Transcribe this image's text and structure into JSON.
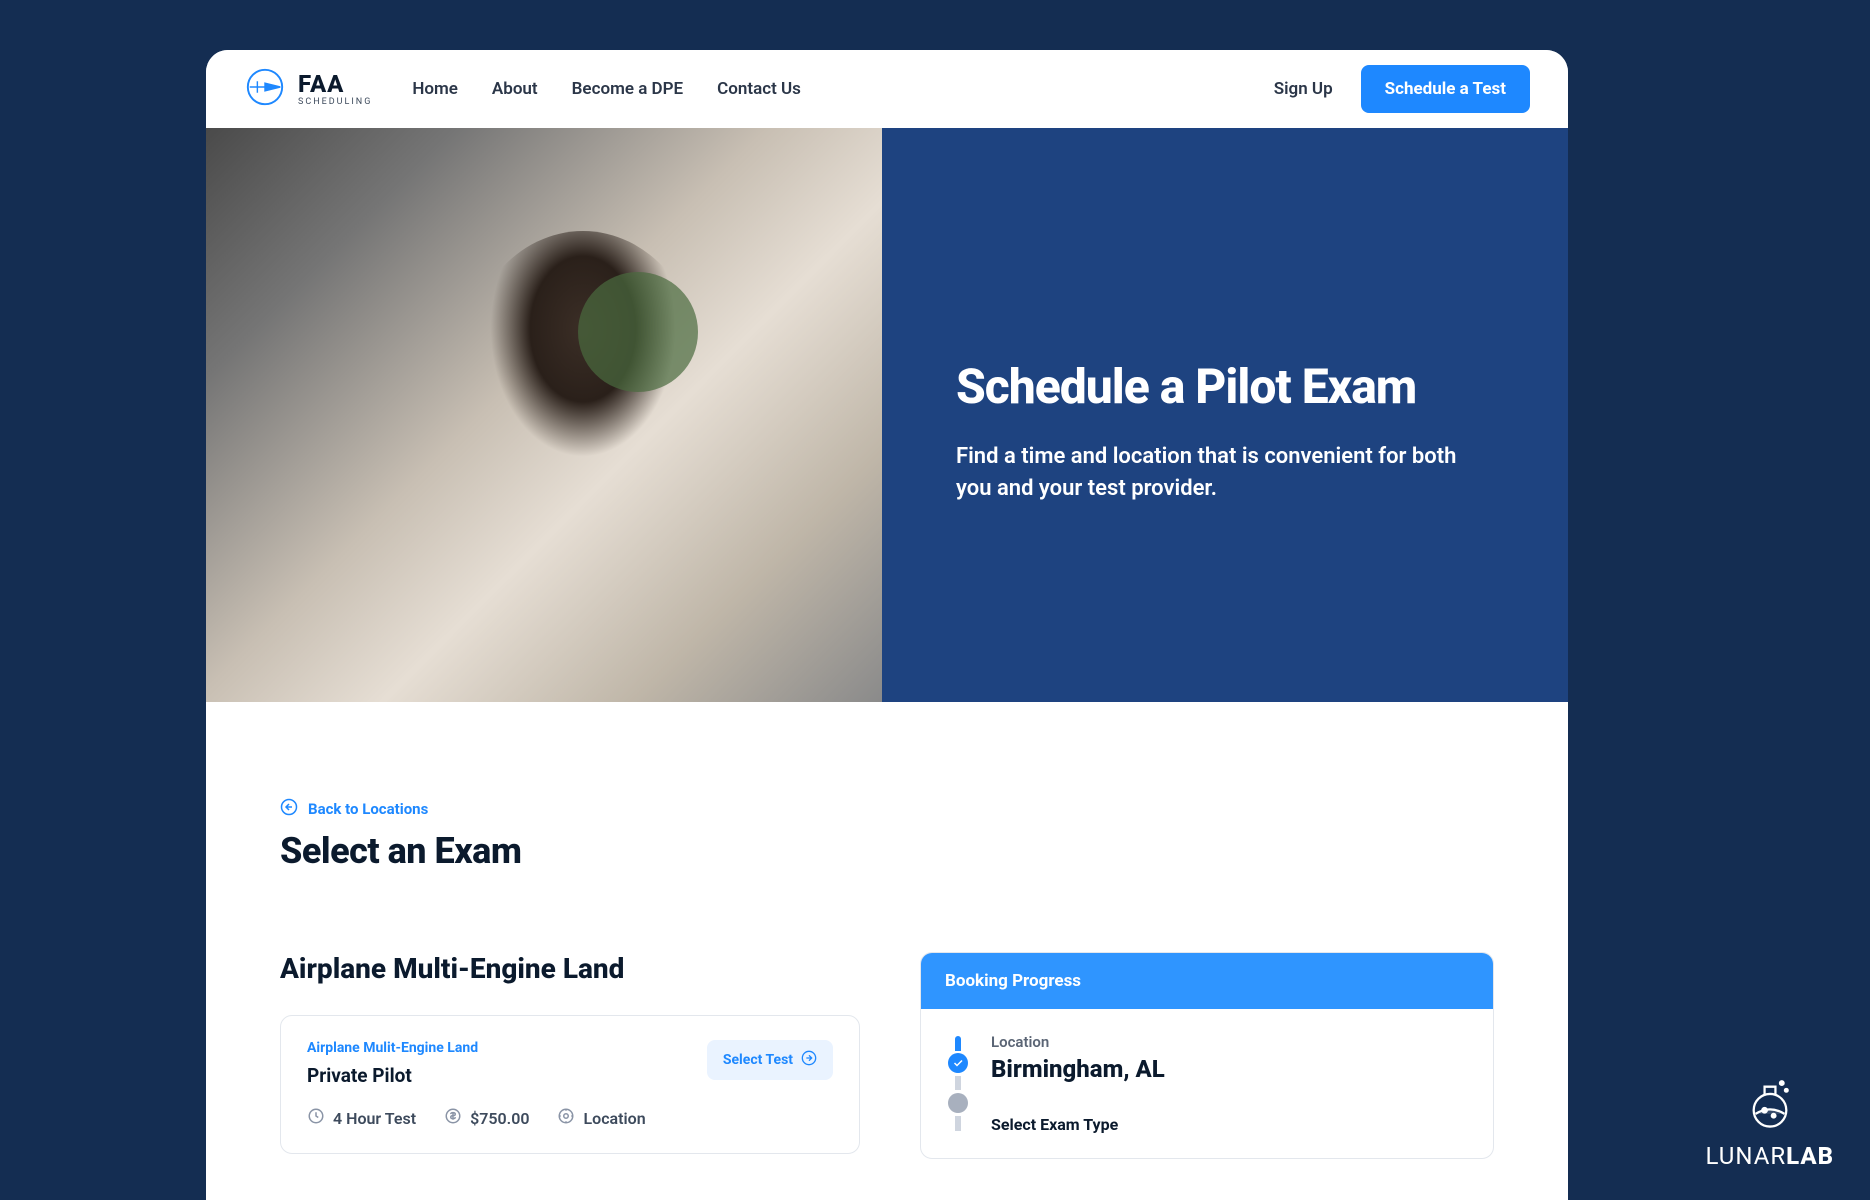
{
  "brand": {
    "main": "FAA",
    "sub": "SCHEDULING"
  },
  "nav": {
    "items": [
      "Home",
      "About",
      "Become a DPE",
      "Contact Us"
    ],
    "signup": "Sign Up",
    "cta": "Schedule a Test"
  },
  "hero": {
    "title": "Schedule a Pilot Exam",
    "sub": "Find a time and location that is convenient for both you and your test provider."
  },
  "back": "Back to Locations",
  "page_title": "Select an Exam",
  "category": "Airplane Multi-Engine Land",
  "exam": {
    "cat": "Airplane Mulit-Engine Land",
    "name": "Private Pilot",
    "select": "Select Test",
    "duration": "4 Hour Test",
    "price": "$750.00",
    "location": "Location"
  },
  "bp": {
    "title": "Booking Progress",
    "step1_label": "Location",
    "step1_value": "Birmingham, AL",
    "step2_label": "Select Exam Type"
  },
  "watermark": {
    "a": "LUNAR",
    "b": "LAB"
  }
}
